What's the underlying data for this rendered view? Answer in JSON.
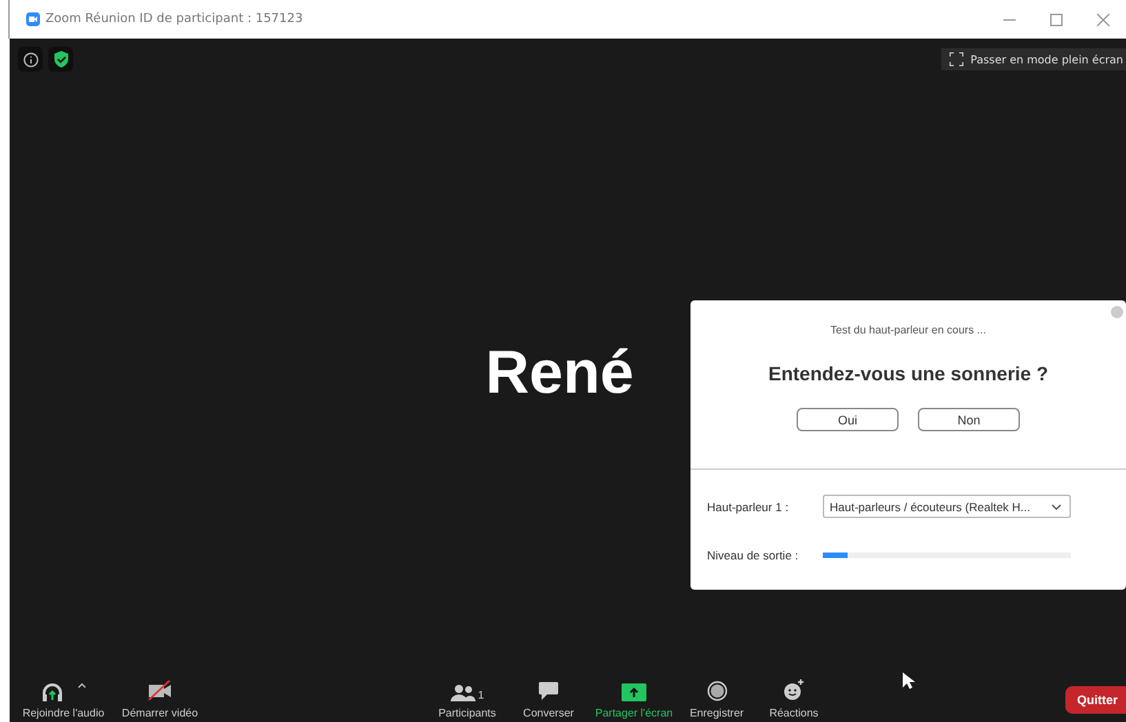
{
  "window": {
    "title": "Zoom Réunion ID de participant : 157123"
  },
  "fullscreen_button": "Passer en mode plein écran",
  "participant_name": "René",
  "dialog": {
    "status": "Test du haut-parleur en cours ...",
    "question": "Entendez-vous une sonnerie ?",
    "buttons": [
      "Oui",
      "Non"
    ],
    "speaker_label": "Haut-parleur 1 :",
    "speaker_value": "Haut-parleurs / écouteurs (Realtek H...",
    "output_label": "Niveau de sortie :",
    "level": 0.1
  },
  "toolbar_left": [
    {
      "kind": "audio",
      "label": "Rejoindre l'audio",
      "active": false
    },
    {
      "kind": "video",
      "label": "Démarrer vidéo",
      "active": false
    }
  ],
  "toolbar_center": [
    {
      "kind": "participants",
      "label": "Participants",
      "count": "1",
      "active": false
    },
    {
      "kind": "chat",
      "label": "Converser",
      "active": false
    },
    {
      "kind": "share",
      "label": "Partager l'écran",
      "active": true
    },
    {
      "kind": "record",
      "label": "Enregistrer",
      "active": false
    },
    {
      "kind": "reactions",
      "label": "Réactions",
      "active": false
    }
  ],
  "quit_button": "Quitter"
}
